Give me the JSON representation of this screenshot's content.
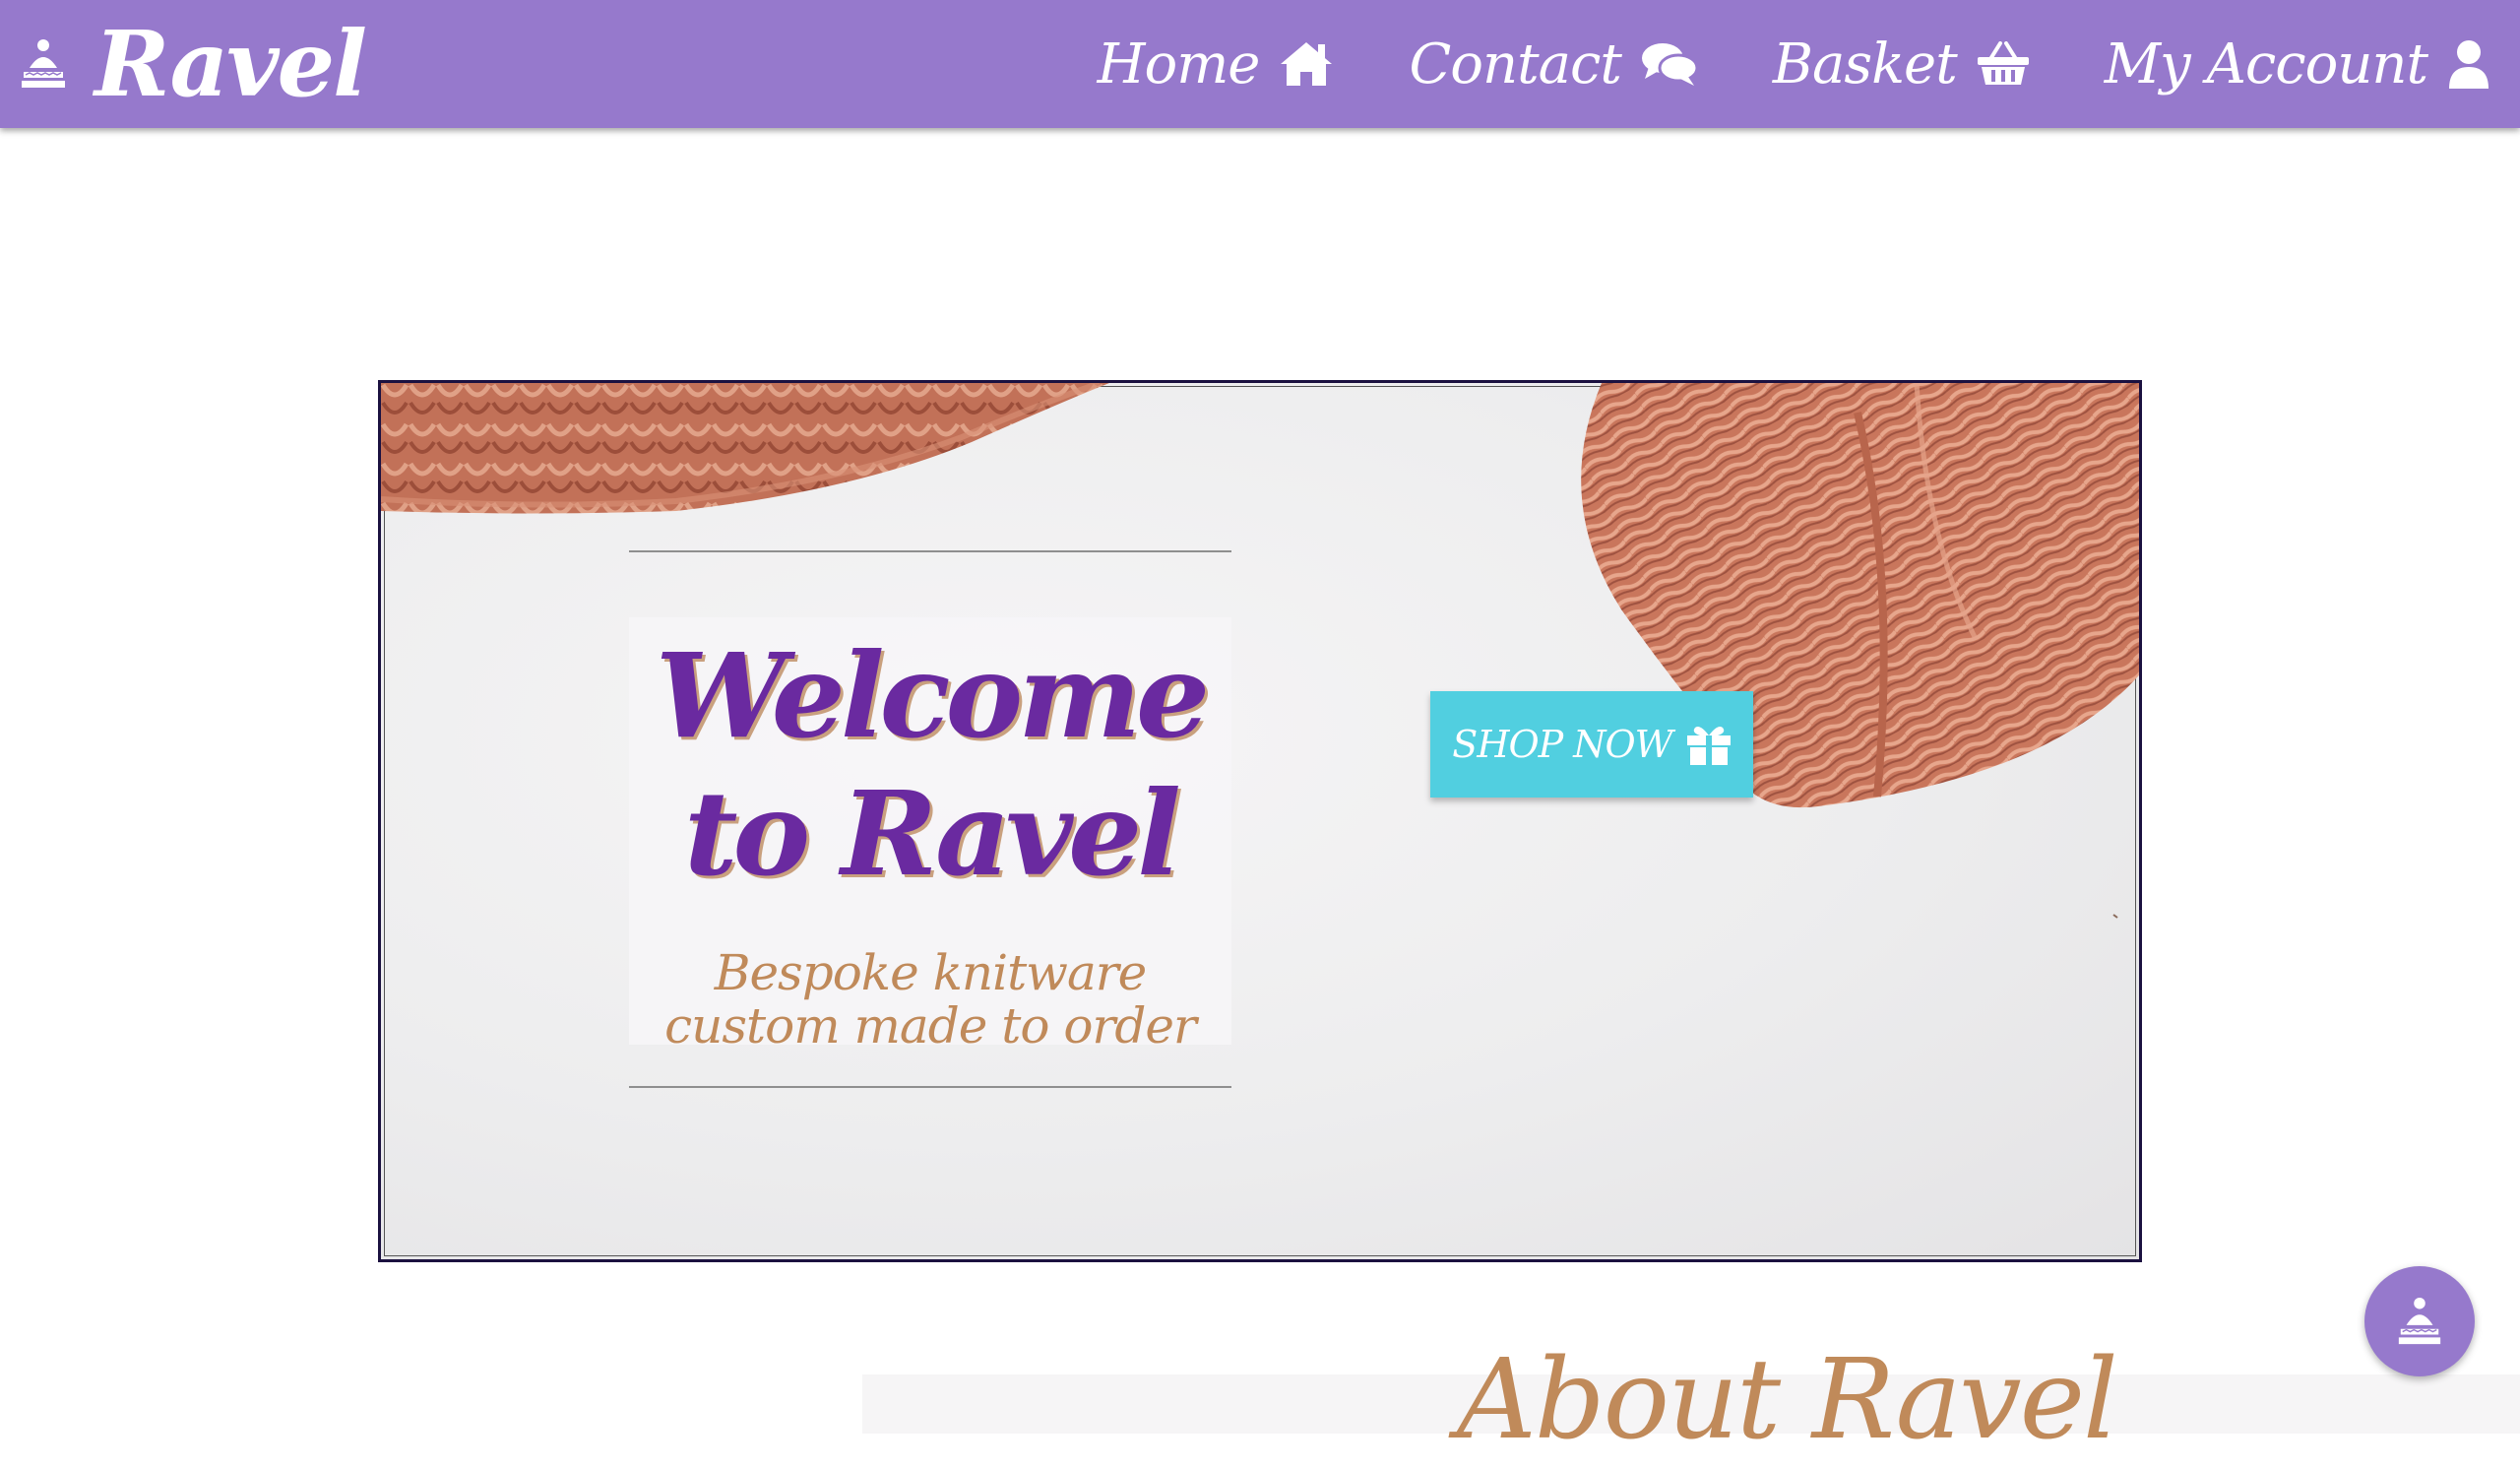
{
  "navbar": {
    "brand_name": "Ravel",
    "brand_icon": "knit-hat-icon",
    "links": [
      {
        "label": "Home",
        "icon": "home-icon"
      },
      {
        "label": "Contact",
        "icon": "chat-icon"
      },
      {
        "label": "Basket",
        "icon": "basket-icon"
      },
      {
        "label": "My Account",
        "icon": "user-icon"
      }
    ]
  },
  "hero": {
    "title_line1": "Welcome",
    "title_line2": "to Ravel",
    "subtitle": "Bespoke knitware custom made to order",
    "cta_label": "SHOP NOW",
    "cta_icon": "gift-icon"
  },
  "about": {
    "title": "About Ravel"
  },
  "fab": {
    "icon": "knit-hat-icon"
  },
  "colors": {
    "navbar": "#9679cc",
    "title_purple": "#6a2aa0",
    "accent_tan": "#c08a5a",
    "cta": "#51cfe0",
    "yarn": "#c5735a"
  }
}
